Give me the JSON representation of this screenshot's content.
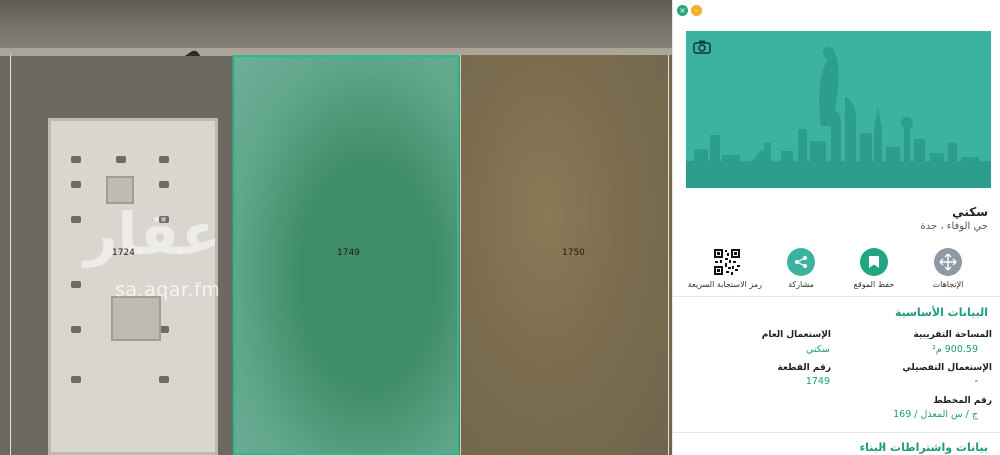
{
  "map": {
    "watermark_brand": "عقار",
    "watermark_url": "sa.aqar.fm",
    "plots": [
      {
        "label": "1724"
      },
      {
        "label": "1749"
      },
      {
        "label": "1750"
      }
    ]
  },
  "panel": {
    "window_controls": {
      "close": "×",
      "minimize": "–"
    },
    "property_type": "سكني",
    "location": "حي الوفاء ، جدة",
    "actions": [
      {
        "label": "الإتجاهات",
        "icon": "directions-icon",
        "color": "#8e99a6"
      },
      {
        "label": "حفظ الموقع",
        "icon": "bookmark-icon",
        "color": "#21a583"
      },
      {
        "label": "مشاركة",
        "icon": "share-icon",
        "color": "#3bb3a0"
      },
      {
        "label": "رمز الاستجابة السريعة",
        "icon": "qr-code-icon",
        "color": "#111111"
      }
    ],
    "basic_data": {
      "title": "البيانات الأساسية",
      "approx_area_label": "المساحة التقريبية",
      "approx_area_value": "900.59 م²",
      "general_use_label": "الإستعمال العام",
      "general_use_value": "سكني",
      "detailed_use_label": "الإستعمال التفصيلي",
      "detailed_use_value": "-",
      "plot_number_label": "رقم القطعة",
      "plot_number_value": "1749",
      "scheme_number_label": "رقم المخطط",
      "scheme_number_value": "ج / س المعدل / 169"
    },
    "building_section_title": "بيانات واشتراطات البناء",
    "colors": {
      "accent": "#1f9a80",
      "hero": "#3bb3a0"
    }
  }
}
